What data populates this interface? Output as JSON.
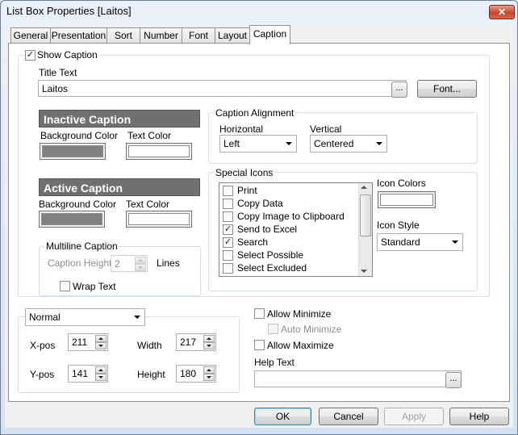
{
  "window": {
    "title": "List Box Properties [Laitos]",
    "close_glyph": "✕"
  },
  "tabs": [
    {
      "label": "General"
    },
    {
      "label": "Presentation"
    },
    {
      "label": "Sort"
    },
    {
      "label": "Number"
    },
    {
      "label": "Font"
    },
    {
      "label": "Layout"
    },
    {
      "label": "Caption",
      "active": true
    }
  ],
  "caption": {
    "show_caption_label": "Show Caption",
    "show_caption_checked": true,
    "title_text_label": "Title Text",
    "title_text_value": "Laitos",
    "ellipsis": "...",
    "font_button": "Font..."
  },
  "inactive": {
    "bar": "Inactive Caption",
    "bg_label": "Background Color",
    "text_label": "Text Color"
  },
  "active": {
    "bar": "Active Caption",
    "bg_label": "Background Color",
    "text_label": "Text Color"
  },
  "alignment": {
    "group_label": "Caption Alignment",
    "horizontal_label": "Horizontal",
    "horizontal_value": "Left",
    "vertical_label": "Vertical",
    "vertical_value": "Centered"
  },
  "multiline": {
    "group_label": "Multiline Caption",
    "height_label": "Caption Height",
    "height_value": "2",
    "lines_label": "Lines",
    "wrap_label": "Wrap Text"
  },
  "special_icons": {
    "group_label": "Special Icons",
    "items": [
      {
        "label": "Print",
        "checked": false
      },
      {
        "label": "Copy Data",
        "checked": false
      },
      {
        "label": "Copy Image to Clipboard",
        "checked": false
      },
      {
        "label": "Send to Excel",
        "checked": true
      },
      {
        "label": "Search",
        "checked": true
      },
      {
        "label": "Select Possible",
        "checked": false
      },
      {
        "label": "Select Excluded",
        "checked": false
      }
    ],
    "icon_colors_label": "Icon Colors",
    "icon_style_label": "Icon Style",
    "icon_style_value": "Standard"
  },
  "position": {
    "mode_value": "Normal",
    "xpos_label": "X-pos",
    "xpos_value": "211",
    "ypos_label": "Y-pos",
    "ypos_value": "141",
    "width_label": "Width",
    "width_value": "217",
    "height_label": "Height",
    "height_value": "180"
  },
  "options": {
    "allow_minimize": "Allow Minimize",
    "auto_minimize": "Auto Minimize",
    "allow_maximize": "Allow Maximize",
    "help_text_label": "Help Text"
  },
  "buttons": {
    "ok": "OK",
    "cancel": "Cancel",
    "apply": "Apply",
    "help": "Help"
  },
  "colors": {
    "caption_bar": "#707070",
    "swatch_fill": "#808080",
    "close_red": "#c4462b"
  }
}
